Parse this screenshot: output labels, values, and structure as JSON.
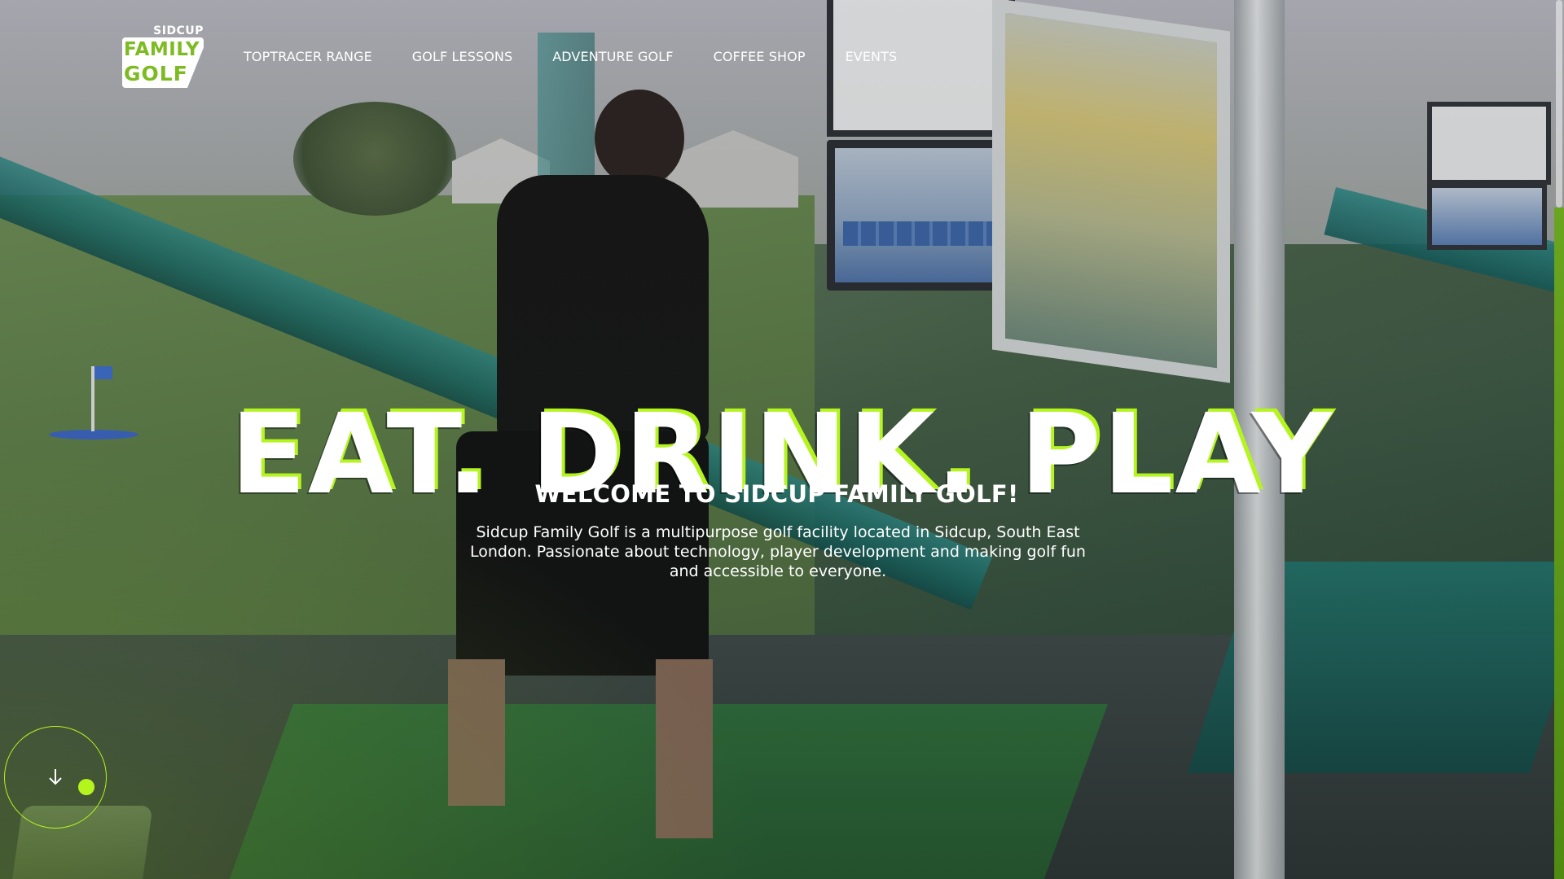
{
  "logo": {
    "top_text": "SIDCUP",
    "line1": "FAMILY",
    "line2": "GOLF"
  },
  "nav": {
    "items": [
      {
        "label": "TOPTRACER RANGE"
      },
      {
        "label": "GOLF LESSONS"
      },
      {
        "label": "ADVENTURE GOLF"
      },
      {
        "label": "COFFEE SHOP"
      },
      {
        "label": "EVENTS"
      }
    ]
  },
  "hero": {
    "headline": "EAT. DRINK. PLAY",
    "subheading": "WELCOME TO SIDCUP FAMILY GOLF!",
    "intro": "Sidcup Family Golf is a multipurpose golf facility located in Sidcup, South East London. Passionate about technology, player development and making golf fun and accessible to everyone."
  },
  "controls": {
    "scroll_icon": "arrow-down-icon"
  },
  "colors": {
    "accent": "#b5f51e",
    "logo_green": "#7dbb22",
    "text": "#ffffff"
  }
}
